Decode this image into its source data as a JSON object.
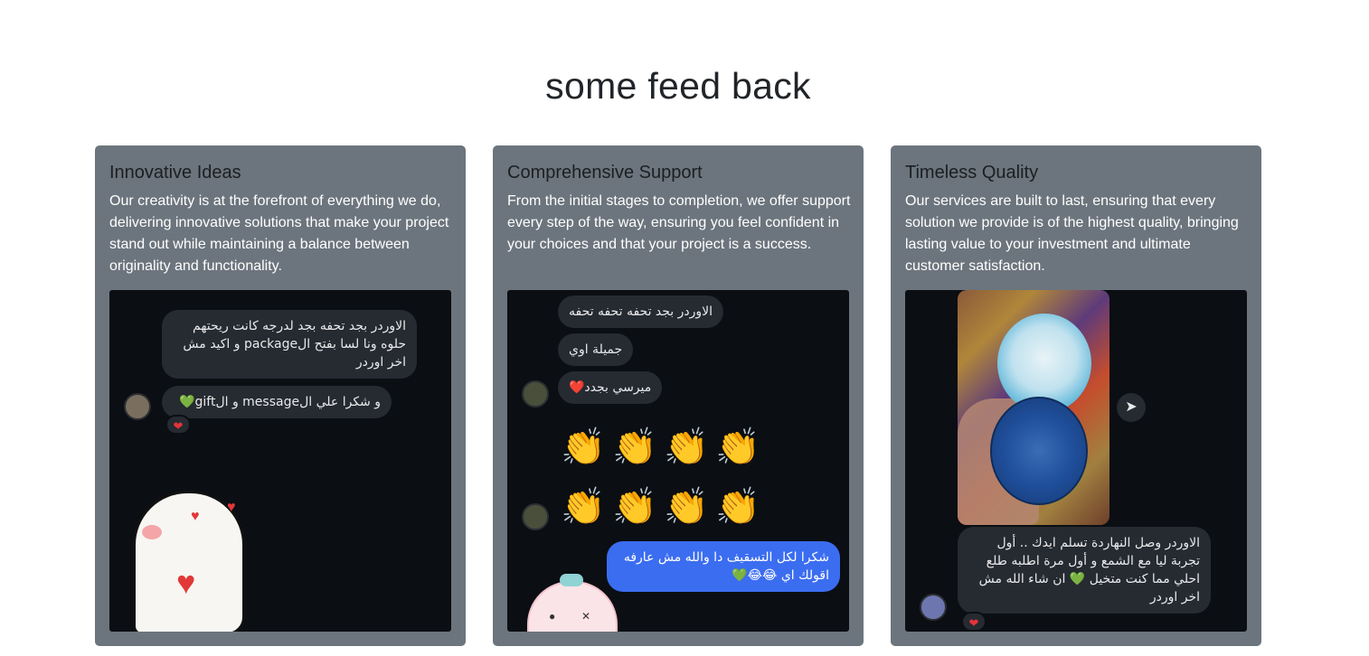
{
  "section": {
    "title": "some feed back"
  },
  "cards": [
    {
      "title": "Innovative Ideas",
      "text": "Our creativity is at the forefront of everything we do, delivering innovative solutions that make your project stand out while maintaining a balance between originality and functionality.",
      "messages": [
        "الاوردر بجد تحفه بجد لدرجه كانت ريحتهم حلوه ونا لسا بفتح الpackage و اكيد مش اخر اوردر",
        "و شكرا علي الmessage و الgift💚"
      ],
      "reaction": "❤"
    },
    {
      "title": "Comprehensive Support",
      "text": "From the initial stages to completion, we offer support every step of the way, ensuring you feel confident in your choices and that your project is a success.",
      "messages": [
        "الاوردر بجد تحفه تحفه تحفه",
        "جميلة اوي",
        "ميرسي بجدد❤️",
        "شكرا لكل التسقيف دا والله مش عارفه اقولك اي 😂😂💚"
      ],
      "clap": "👏"
    },
    {
      "title": "Timeless Quality",
      "text": "Our services are built to last, ensuring that every solution we provide is of the highest quality, bringing lasting value to your investment and ultimate customer satisfaction.",
      "messages": [
        "الاوردر وصل النهاردة تسلم ايدك .. أول تجربة ليا مع الشمع و أول مرة اطلبه طلع احلي مما كنت متخيل 💚 ان شاء الله مش اخر اوردر"
      ],
      "reaction": "❤",
      "share_icon": "send-icon"
    }
  ]
}
